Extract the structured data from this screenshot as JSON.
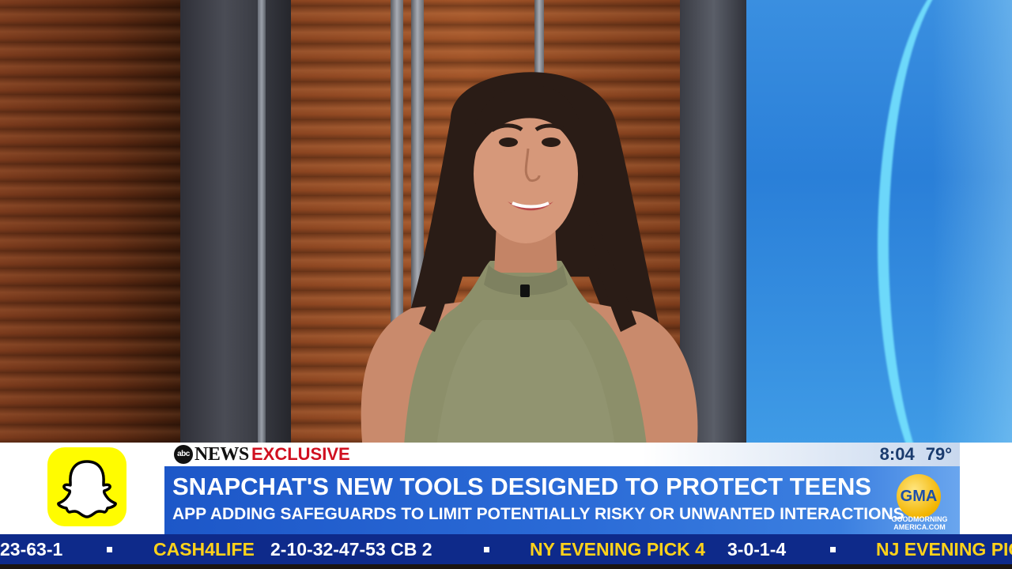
{
  "lower_third": {
    "network": "NEWS",
    "network_mark": "abc",
    "tag": "EXCLUSIVE",
    "time": "8:04",
    "temperature": "79°",
    "headline": "SNAPCHAT'S NEW TOOLS DESIGNED TO PROTECT TEENS",
    "subline": "APP ADDING SAFEGUARDS TO LIMIT POTENTIALLY RISKY OR UNWANTED INTERACTIONS",
    "left_logo_icon": "snapchat-ghost-icon",
    "right_bug": {
      "mark": "GMA",
      "line1": "GOODMORNING",
      "line2": "AMERICA.COM"
    }
  },
  "ticker": {
    "items": [
      {
        "text": "23-63-1",
        "style": "white"
      },
      {
        "text": "CASH4LIFE",
        "style": "yellow"
      },
      {
        "text": "2-10-32-47-53 CB 2",
        "style": "white"
      },
      {
        "text": "NY EVENING PICK 4",
        "style": "yellow"
      },
      {
        "text": "3-0-1-4",
        "style": "white"
      },
      {
        "text": "NJ EVENING PICK",
        "style": "yellow"
      }
    ]
  },
  "colors": {
    "snapchat_yellow": "#FFFC00",
    "headline_blue": "#2a6ad6",
    "exclusive_red": "#d01020",
    "ticker_blue": "#0e2a8a",
    "ticker_yellow": "#ffd21a",
    "gma_gold": "#f2b400"
  }
}
